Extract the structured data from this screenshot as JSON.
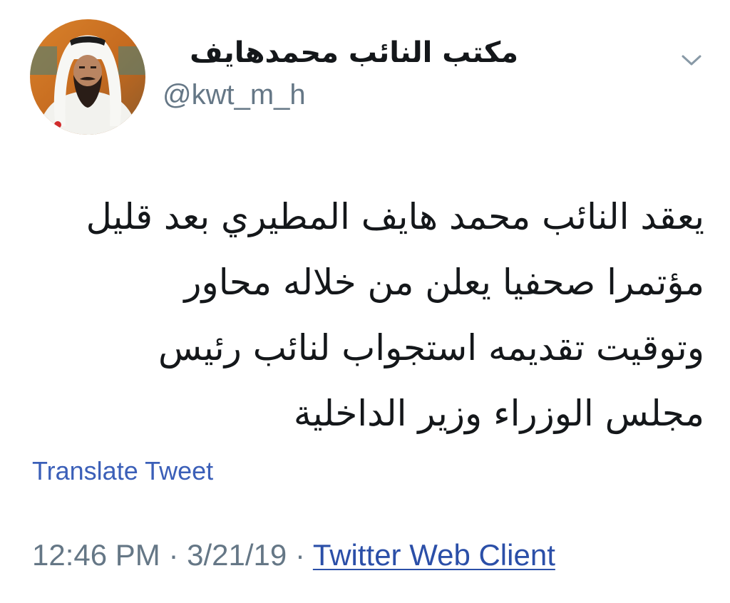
{
  "tweet": {
    "author": {
      "display_name": "مكتب النائب محمدهايف",
      "handle": "@kwt_m_h"
    },
    "text_lines": [
      "يعقد النائب محمد هايف المطيري بعد قليل",
      "مؤتمرا صحفيا يعلن من خلاله محاور",
      "وتوقيت تقديمه استجواب لنائب رئيس",
      "مجلس الوزراء وزير الداخلية"
    ],
    "translate_label": "Translate Tweet",
    "time": "12:46 PM",
    "date": "3/21/19",
    "separator": "·",
    "source": "Twitter Web Client"
  },
  "icons": {
    "menu": "chevron-down-icon"
  },
  "colors": {
    "text_primary": "#14171a",
    "text_secondary": "#657786",
    "link": "#3b5fb8",
    "background": "#ffffff"
  }
}
